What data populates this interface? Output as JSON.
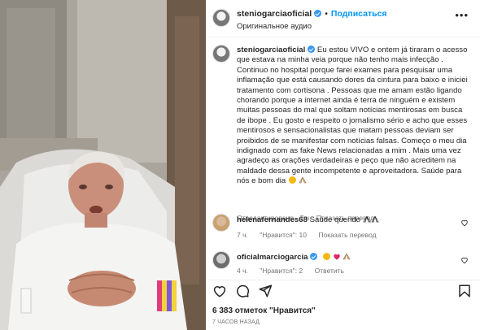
{
  "colors": {
    "accent_blue": "#0095f6",
    "verified_blue": "#3897f0",
    "meta_gray": "#737373",
    "text": "#262626"
  },
  "header": {
    "username": "steniogarciaoficial",
    "follow_label": "Подписаться",
    "audio_label": "Оригинальное аудио",
    "more_icon": "more-horizontal-icon"
  },
  "caption": {
    "username": "steniogarciaoficial",
    "text": "Eu estou VIVO e ontem já tiraram o acesso que estava na minha veia porque não tenho mais infecção . Continuo no hospital porque farei exames para pesquisar uma inflamação que está causando dores da cintura para baixo e iniciei tratamento com cortisona . Pessoas que me amam estão ligando chorando porque a internet ainda é terra de ninguém e existem muitas pessoas do mal que soltam notícias mentirosas em busca de ibope . Eu gosto e respeito o jornalismo sério e acho que esses mentirosos e sensacionalistas que matam pessoas deviam ser proibidos de se manifestar com notícias falsas. Começo o meu dia indignado com as fake News relacionadas a mim . Mais uma vez agradeço as orações verdadeiras e peço que não acreditem na maldade dessa gente incompetente e aproveitadora. Saúde para nós e bom dia",
    "emoji_icons": [
      "smiling-face-icon",
      "praying-hands-icon"
    ],
    "meta_edited": "Отредактировано",
    "meta_time": "7 ч.",
    "meta_translate": "Показать перевод"
  },
  "comments": [
    {
      "username": "helenafernandes68",
      "text": "Saúde querido",
      "emoji_icons": [
        "praying-hands-icon"
      ],
      "time": "7 ч.",
      "likes": "\"Нравится\": 10",
      "translate": "Показать перевод"
    },
    {
      "username": "oficialmarciogarcia",
      "text": "",
      "emoji_icons": [
        "crying-face-icon",
        "red-heart-icon",
        "praying-hands-icon"
      ],
      "time": "4 ч.",
      "likes": "\"Нравится\": 2",
      "translate": "Ответить"
    }
  ],
  "actions": {
    "icons": [
      "heart-icon",
      "comment-icon",
      "share-icon",
      "bookmark-icon"
    ]
  },
  "likes_text": "6 383 отметок \"Нравится\"",
  "time_ago": "7 ЧАСОВ НАЗАД"
}
